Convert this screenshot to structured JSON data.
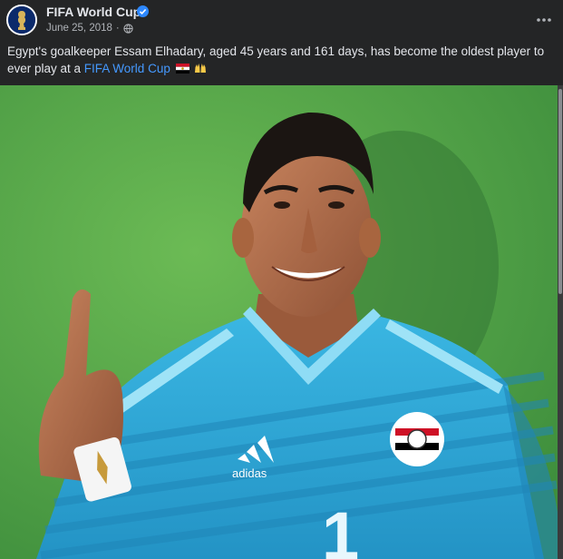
{
  "post": {
    "author": "FIFA World Cup",
    "date": "June 25, 2018",
    "date_separator": "·",
    "caption_text": "Egypt's goalkeeper Essam Elhadary, aged 45 years and 161 days, has become the oldest player to ever play at a ",
    "caption_link": "FIFA World Cup",
    "emojis": [
      "egypt-flag",
      "raising-hands"
    ]
  },
  "icons": {
    "verified": "verified-badge-icon",
    "privacy": "globe-icon",
    "more": "more-options-icon"
  },
  "photo": {
    "jersey_brand": "adidas",
    "jersey_number": "1"
  },
  "colors": {
    "background": "#242526",
    "link": "#4599ff",
    "verified": "#2d88ff",
    "jersey": "#2fa9d8",
    "backdrop": "#5aa84b"
  }
}
